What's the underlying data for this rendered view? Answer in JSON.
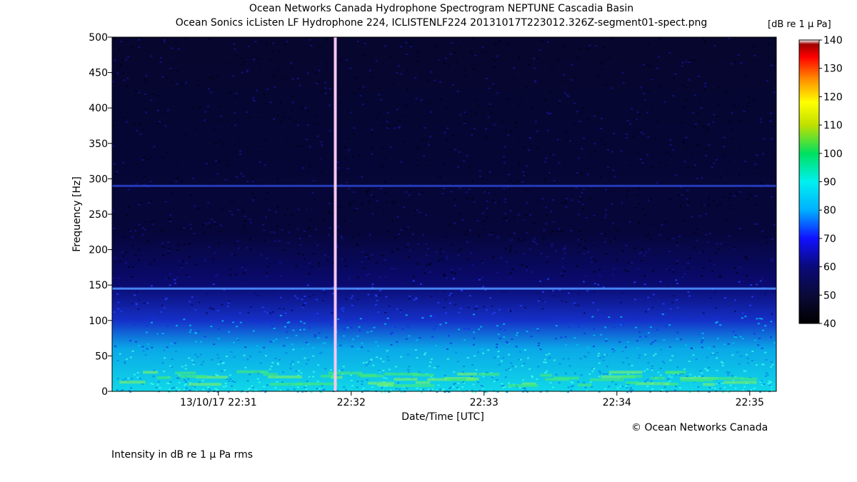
{
  "chart_data": {
    "type": "heatmap",
    "title": "Ocean Networks Canada Hydrophone Spectrogram NEPTUNE Cascadia Basin",
    "subtitle": "Ocean Sonics icListen LF Hydrophone 224, ICLISTENLF224 20131017T223012.326Z-segment01-spect.png",
    "xlabel": "Date/Time [UTC]",
    "ylabel": "Frequency [Hz]",
    "x_ticks": [
      {
        "label": "13/10/17 22:31",
        "minute": 31
      },
      {
        "label": "22:32",
        "minute": 32
      },
      {
        "label": "22:33",
        "minute": 33
      },
      {
        "label": "22:34",
        "minute": 34
      },
      {
        "label": "22:35",
        "minute": 35
      }
    ],
    "xlim_minutes": [
      30.2,
      35.2
    ],
    "y_ticks": [
      0,
      50,
      100,
      150,
      200,
      250,
      300,
      350,
      400,
      450,
      500
    ],
    "ylim": [
      0,
      500
    ],
    "colorbar": {
      "unit": "[dB re 1 μ Pa]",
      "ticks": [
        40,
        50,
        60,
        70,
        80,
        90,
        100,
        110,
        120,
        130,
        140
      ],
      "range": [
        40,
        140
      ]
    },
    "features": {
      "broadband_event_minute": 31.88,
      "tonal_lines_hz": [
        145,
        290
      ]
    },
    "copyright": "© Ocean Networks Canada",
    "footnote": "Intensity in dB re 1 μ Pa rms"
  }
}
